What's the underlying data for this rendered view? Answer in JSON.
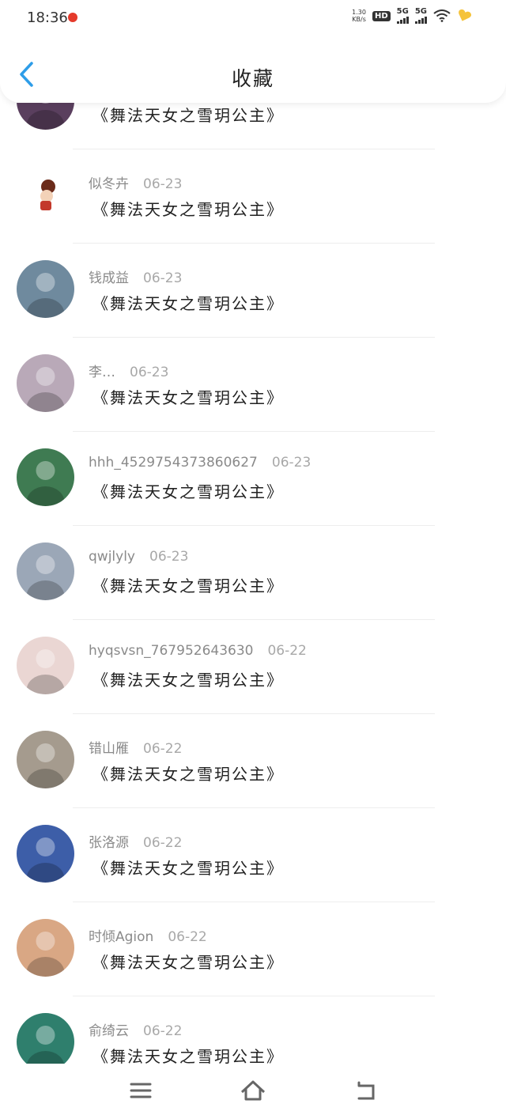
{
  "status_bar": {
    "time": "18:36",
    "net_speed_value": "1.30",
    "net_speed_unit": "KB/s",
    "hd_label": "HD",
    "sim1": "1",
    "sim2": "2",
    "network1": "5G",
    "network2": "5G"
  },
  "header": {
    "title": "收藏"
  },
  "items": [
    {
      "user": "",
      "date": "",
      "content": "《舞法天女之雪玥公主》",
      "avatar_color": "#5a3f5e"
    },
    {
      "user": "似冬卉",
      "date": "06-23",
      "content": "《舞法天女之雪玥公主》",
      "avatar_color": "#ffffff"
    },
    {
      "user": "钱成益",
      "date": "06-23",
      "content": "《舞法天女之雪玥公主》",
      "avatar_color": "#6f8a9e"
    },
    {
      "user": "李…",
      "date": "06-23",
      "content": "《舞法天女之雪玥公主》",
      "avatar_color": "#b9a9b8"
    },
    {
      "user": "hhh_4529754373860627",
      "date": "06-23",
      "content": "《舞法天女之雪玥公主》",
      "avatar_color": "#3f7b52"
    },
    {
      "user": "qwjlyly",
      "date": "06-23",
      "content": "《舞法天女之雪玥公主》",
      "avatar_color": "#9ba7b7"
    },
    {
      "user": "hyqsvsn_767952643630",
      "date": "06-22",
      "content": "《舞法天女之雪玥公主》",
      "avatar_color": "#ead6d3"
    },
    {
      "user": "错山雁",
      "date": "06-22",
      "content": "《舞法天女之雪玥公主》",
      "avatar_color": "#a59b8e"
    },
    {
      "user": "张洛源",
      "date": "06-22",
      "content": "《舞法天女之雪玥公主》",
      "avatar_color": "#3d5ea8"
    },
    {
      "user": "时倾Agion",
      "date": "06-22",
      "content": "《舞法天女之雪玥公主》",
      "avatar_color": "#d9a784"
    },
    {
      "user": "俞绮云",
      "date": "06-22",
      "content": "《舞法天女之雪玥公主》",
      "avatar_color": "#2f7f6d"
    }
  ],
  "colors": {
    "back_arrow": "#2e9de8",
    "status_dot": "#e53a2b",
    "heart": "#f5c33b"
  },
  "icons": {
    "back": "chevron-left-icon",
    "menu": "menu-icon",
    "home": "home-icon",
    "return": "return-icon"
  }
}
